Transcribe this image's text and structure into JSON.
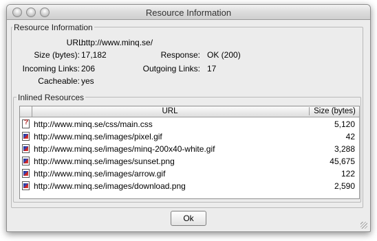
{
  "window": {
    "title": "Resource Information"
  },
  "info": {
    "group_label": "Resource Information",
    "url_label": "URL:",
    "url_value": "http://www.minq.se/",
    "size_label": "Size (bytes):",
    "size_value": "17,182",
    "response_label": "Response:",
    "response_value": "OK (200)",
    "incoming_label": "Incoming Links:",
    "incoming_value": "206",
    "outgoing_label": "Outgoing Links:",
    "outgoing_value": "17",
    "cacheable_label": "Cacheable:",
    "cacheable_value": "yes"
  },
  "inlined": {
    "group_label": "Inlined Resources",
    "columns": [
      "URL",
      "Size (bytes)"
    ],
    "rows": [
      {
        "icon": "css-file-icon",
        "url": "http://www.minq.se/css/main.css",
        "size": "5,120"
      },
      {
        "icon": "image-file-icon",
        "url": "http://www.minq.se/images/pixel.gif",
        "size": "42"
      },
      {
        "icon": "image-file-icon",
        "url": "http://www.minq.se/images/minq-200x40-white.gif",
        "size": "3,288"
      },
      {
        "icon": "image-file-icon",
        "url": "http://www.minq.se/images/sunset.png",
        "size": "45,675"
      },
      {
        "icon": "image-file-icon",
        "url": "http://www.minq.se/images/arrow.gif",
        "size": "122"
      },
      {
        "icon": "image-file-icon",
        "url": "http://www.minq.se/images/download.png",
        "size": "2,590"
      }
    ]
  },
  "buttons": {
    "ok_label": "Ok"
  }
}
